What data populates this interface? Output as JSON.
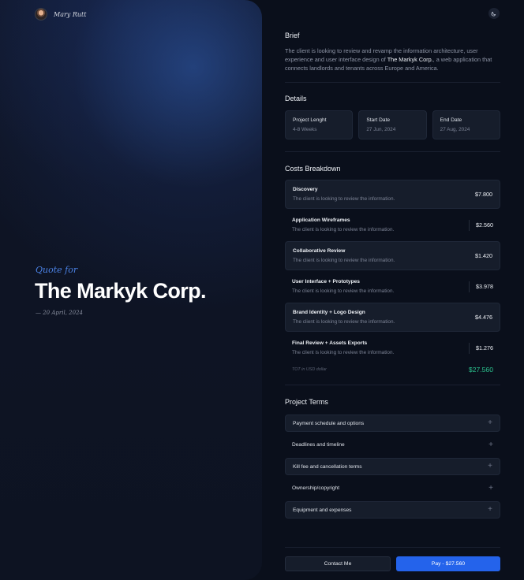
{
  "author": {
    "name": "Mary Rutt"
  },
  "hero": {
    "quote_for": "Quote for",
    "client": "The Markyk Corp.",
    "date": "— 20 April, 2024"
  },
  "brief": {
    "title": "Brief",
    "text_before": "The client is looking to review and revamp the information architecture, user experience and user interface design of ",
    "client_highlight": "The Markyk Corp.",
    "text_after": ", a web application that connects landlords and tenants across Europe and America."
  },
  "details": {
    "title": "Details",
    "items": [
      {
        "label": "Project Lenght",
        "value": "4-8 Weeks"
      },
      {
        "label": "Start Date",
        "value": "27 Jun, 2024"
      },
      {
        "label": "End Date",
        "value": "27 Aug, 2024"
      }
    ]
  },
  "costs": {
    "title": "Costs Breakdown",
    "items": [
      {
        "name": "Discovery",
        "desc": "The client is looking to review the information.",
        "price": "$7.800"
      },
      {
        "name": "Application Wireframes",
        "desc": "The client is looking to review the information.",
        "price": "$2.560"
      },
      {
        "name": "Collaborative Review",
        "desc": "The client is looking to review the information.",
        "price": "$1.420"
      },
      {
        "name": "User Interface + Prototypes",
        "desc": "The client is looking to review the information.",
        "price": "$3.978"
      },
      {
        "name": "Brand Identity + Logo Design",
        "desc": "The client is looking to review the information.",
        "price": "$4.476"
      },
      {
        "name": "Final Review + Assets Exports",
        "desc": "The client is looking to review the information.",
        "price": "$1.276"
      }
    ],
    "total_label": "TOT in USD dollar",
    "total_value": "$27.560"
  },
  "terms": {
    "title": "Project Terms",
    "items": [
      {
        "label": "Payment schedule and options"
      },
      {
        "label": "Deadlines and timeline"
      },
      {
        "label": "Kill fee and cancellation terms"
      },
      {
        "label": "Ownership/copyright"
      },
      {
        "label": "Equipment and expenses"
      }
    ]
  },
  "actions": {
    "contact_label": "Contact Me",
    "pay_label": "Pay - $27.560"
  },
  "colors": {
    "accent": "#2463eb",
    "total_green": "#2bc28e",
    "quote_for_blue": "#4b82e6"
  },
  "icons": {
    "theme_toggle": "moon-icon",
    "term_expand": "plus-icon"
  }
}
